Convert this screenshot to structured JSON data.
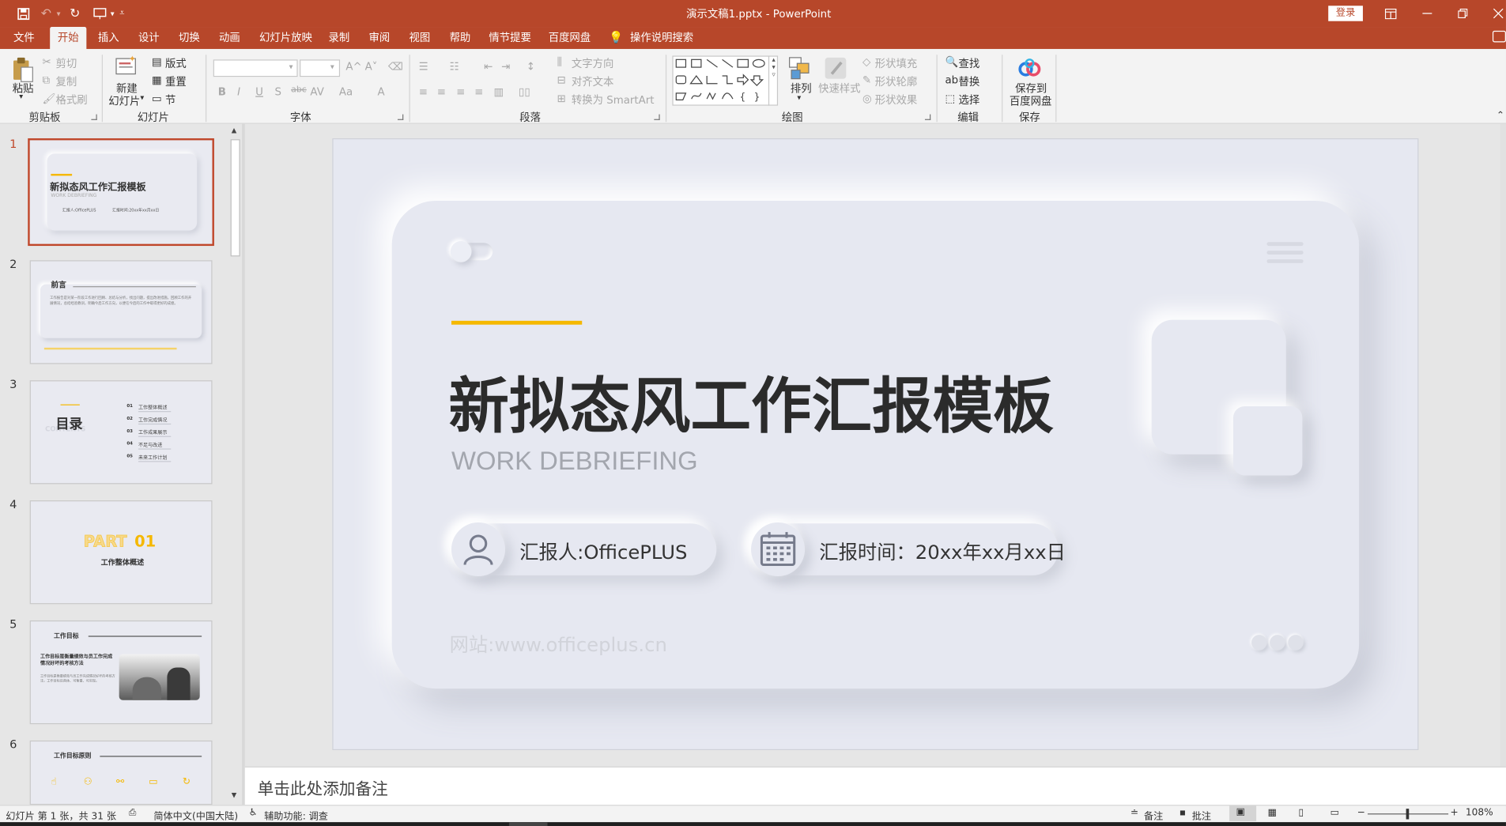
{
  "titlebar": {
    "title": "演示文稿1.pptx  -  PowerPoint",
    "login": "登录"
  },
  "tabs": [
    "文件",
    "开始",
    "插入",
    "设计",
    "切换",
    "动画",
    "幻灯片放映",
    "录制",
    "审阅",
    "视图",
    "帮助",
    "情节提要",
    "百度网盘"
  ],
  "tell_me": "操作说明搜索",
  "ribbon": {
    "clipboard": {
      "paste": "粘贴",
      "cut": "剪切",
      "copy": "复制",
      "format_painter": "格式刷",
      "label": "剪贴板"
    },
    "slides": {
      "new_slide_1": "新建",
      "new_slide_2": "幻灯片",
      "layout": "版式",
      "reset": "重置",
      "section": "节",
      "label": "幻灯片"
    },
    "font": {
      "label": "字体",
      "bold": "B",
      "italic": "I",
      "underline": "U",
      "strike": "S",
      "abc": "abc",
      "av": "AV",
      "aa": "Aa",
      "a": "A",
      "grow": "A^",
      "shrink": "A˅"
    },
    "paragraph": {
      "text_direction": "文字方向",
      "align_text": "对齐文本",
      "smartart": "转换为 SmartArt",
      "label": "段落"
    },
    "drawing": {
      "arrange": "排列",
      "quick_styles": "快速样式",
      "shape_fill": "形状填充",
      "shape_outline": "形状轮廓",
      "shape_effects": "形状效果",
      "label": "绘图"
    },
    "editing": {
      "find": "查找",
      "replace": "替换",
      "select": "选择",
      "label": "编辑"
    },
    "save": {
      "line1": "保存到",
      "line2": "百度网盘",
      "label": "保存"
    }
  },
  "thumbnails": [
    {
      "num": "1",
      "title": "新拟态风工作汇报模板",
      "sub": "WORK DEBRIEFING",
      "a": "汇报人:OfficePLUS",
      "b": "汇报时间:20xx年xx月xx日"
    },
    {
      "num": "2",
      "title": "前言",
      "body": "工作报告是对某一阶段工作进行回顾、总结与分析，找出问题，提出改进措施。回顾工作的开展情况，总结经验教训，明确今后工作方向，以便在今后的工作中取得更好的成绩。"
    },
    {
      "num": "3",
      "title": "目录",
      "ghost": "CONTENTS",
      "items": [
        {
          "n": "01",
          "t": "工作整体概述"
        },
        {
          "n": "02",
          "t": "工作完成情况"
        },
        {
          "n": "03",
          "t": "工作成果展示"
        },
        {
          "n": "04",
          "t": "不足与改进"
        },
        {
          "n": "05",
          "t": "未来工作计划"
        }
      ]
    },
    {
      "num": "4",
      "part": "PART",
      "part_num": "01",
      "sub": "工作整体概述"
    },
    {
      "num": "5",
      "title": "工作目标",
      "heading": "工作目标是衡量绩效与员工作完成情况好坏的考核方法",
      "body": "工作目标是衡量绩效与员工作完成情况好坏的考核方法，工作目标应具体、可衡量、可实现。"
    },
    {
      "num": "6",
      "title": "工作目标原则"
    }
  ],
  "slide": {
    "title": "新拟态风工作汇报模板",
    "subtitle": "WORK DEBRIEFING",
    "reporter": "汇报人:OfficePLUS",
    "time": "汇报时间：20xx年xx月xx日",
    "website": "网站:www.officeplus.cn"
  },
  "notes": {
    "placeholder": "单击此处添加备注"
  },
  "status": {
    "slide_info": "幻灯片 第 1 张，共 31 张",
    "language": "简体中文(中国大陆)",
    "accessibility": "辅助功能: 调查",
    "notes": "备注",
    "comments": "批注",
    "zoom": "108%"
  },
  "colors": {
    "accent": "#b7472a",
    "yellow": "#f5b800",
    "slide_bg": "#e6e8f1",
    "text_dark": "#333333"
  }
}
